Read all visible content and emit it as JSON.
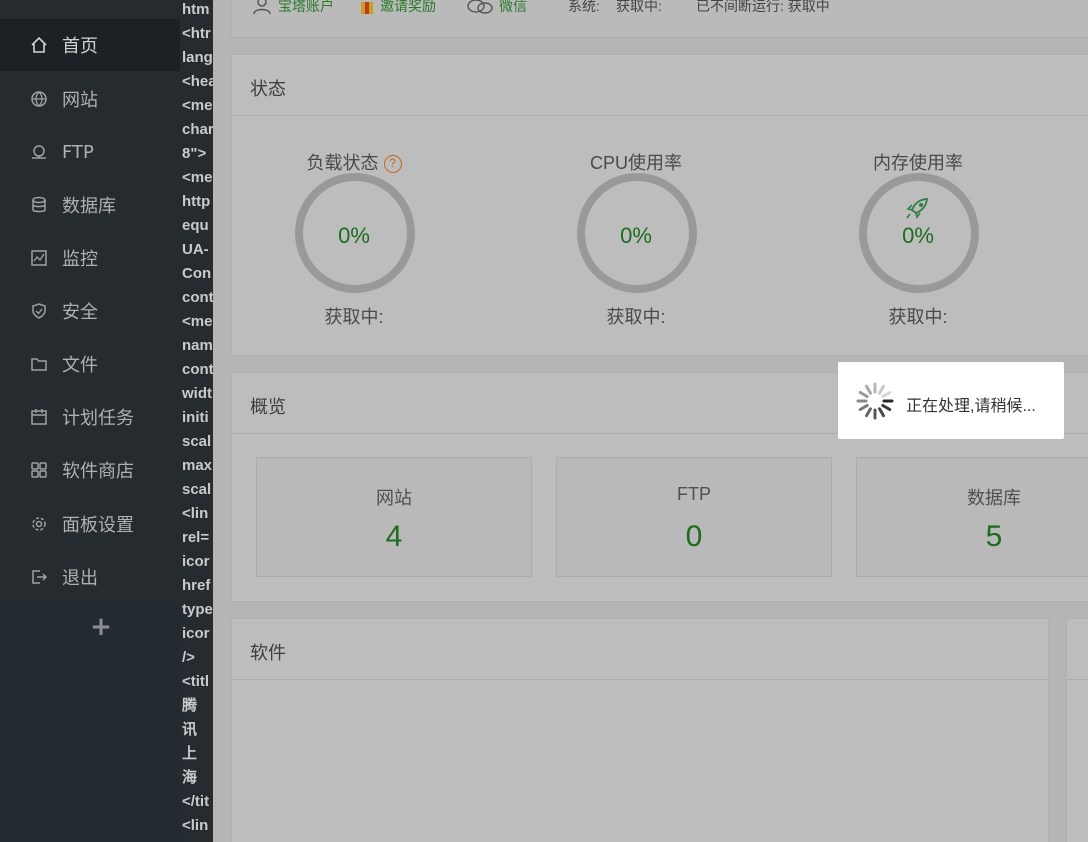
{
  "sidebar": {
    "items": [
      {
        "label": "首页",
        "icon": "home-icon"
      },
      {
        "label": "网站",
        "icon": "globe-icon"
      },
      {
        "label": "FTP",
        "icon": "ftp-icon"
      },
      {
        "label": "数据库",
        "icon": "database-icon"
      },
      {
        "label": "监控",
        "icon": "monitor-icon"
      },
      {
        "label": "安全",
        "icon": "shield-icon"
      },
      {
        "label": "文件",
        "icon": "folder-icon"
      },
      {
        "label": "计划任务",
        "icon": "calendar-icon"
      },
      {
        "label": "软件商店",
        "icon": "apps-icon"
      },
      {
        "label": "面板设置",
        "icon": "gear-icon"
      },
      {
        "label": "退出",
        "icon": "logout-icon"
      }
    ],
    "add_label": "+"
  },
  "code_strip": [
    "htm",
    "<htr",
    "lang",
    "<hea",
    "<me",
    "char",
    "8\">",
    "<me",
    "http",
    "equ",
    "UA-",
    "Con",
    "cont",
    "<me",
    "nam",
    "cont",
    "widt",
    "initi",
    "scal",
    "max",
    "scal",
    "<lin",
    "rel=",
    "icor",
    "href",
    "type",
    "icor",
    "/>",
    "<titl",
    "腾",
    "讯",
    "上",
    "海",
    "</tit",
    "<lin"
  ],
  "topbar": {
    "account": "宝塔账户",
    "invite": "邀请奖励",
    "wechat": "微信",
    "system_label": "系统:",
    "system_value": "获取中:",
    "uptime": "已不间断运行: 获取中"
  },
  "status": {
    "title": "状态",
    "gauges": [
      {
        "title": "负载状态",
        "value": "0%",
        "status": "获取中:",
        "help": "?"
      },
      {
        "title": "CPU使用率",
        "value": "0%",
        "status": "获取中:"
      },
      {
        "title": "内存使用率",
        "value": "0%",
        "status": "获取中:"
      }
    ]
  },
  "overview": {
    "title": "概览",
    "stats": [
      {
        "label": "网站",
        "value": "4"
      },
      {
        "label": "FTP",
        "value": "0"
      },
      {
        "label": "数据库",
        "value": "5"
      }
    ]
  },
  "software": {
    "title": "软件"
  },
  "loading": {
    "text": "正在处理,请稍候..."
  },
  "colors": {
    "accent_green": "#1c6d1c",
    "sidebar_bg": "#262b30",
    "help_orange": "#c8641e"
  }
}
